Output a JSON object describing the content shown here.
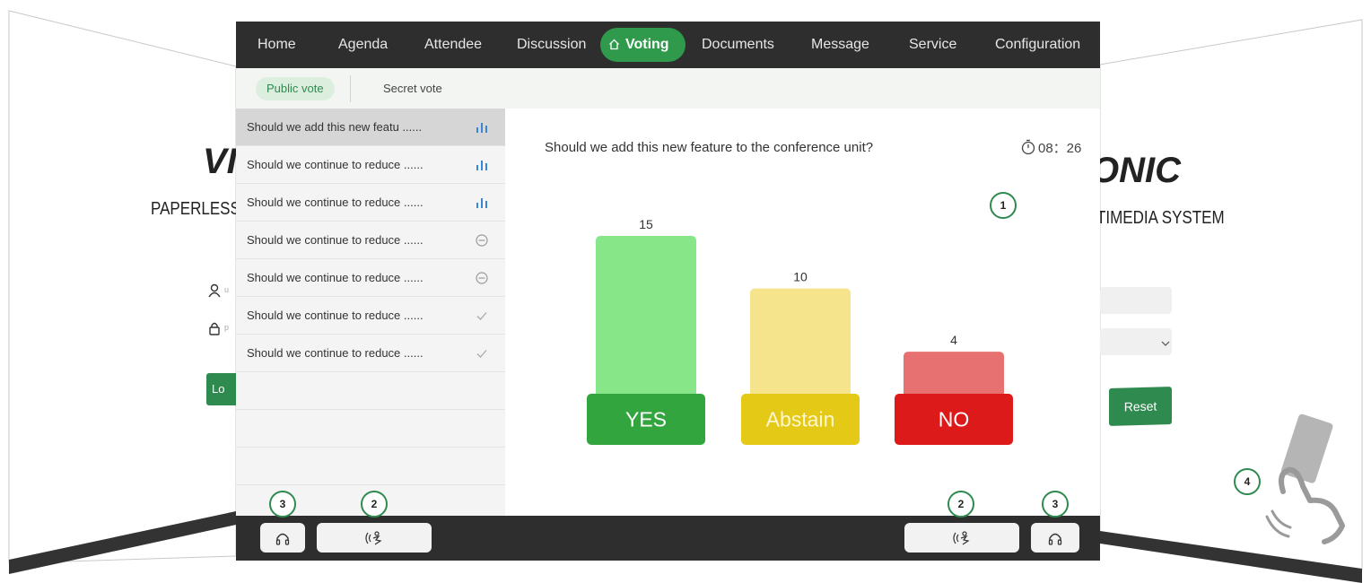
{
  "background": {
    "left_brand": "VI",
    "left_subtitle": "PAPERLESS",
    "right_brand": "ONIC",
    "right_subtitle": "TIMEDIA SYSTEM",
    "left_login_label": "Lo",
    "left_user_hint": "u",
    "left_pass_hint": "p",
    "right_reset_label": "Reset",
    "card_icon": "card-tap-icon"
  },
  "nav": {
    "items": [
      {
        "label": "Home"
      },
      {
        "label": "Agenda"
      },
      {
        "label": "Attendee"
      },
      {
        "label": "Discussion"
      },
      {
        "label": "Voting"
      },
      {
        "label": "Documents"
      },
      {
        "label": "Message"
      },
      {
        "label": "Service"
      },
      {
        "label": "Configuration"
      }
    ],
    "active_index": 4,
    "active_icon": "home-outline-icon"
  },
  "tabs": {
    "public": "Public vote",
    "secret": "Secret vote"
  },
  "vote_list": [
    {
      "title": "Should we add this new featu ......",
      "status_icon": "bar-chart-icon"
    },
    {
      "title": "Should we continue to reduce ......",
      "status_icon": "bar-chart-icon"
    },
    {
      "title": "Should we continue to reduce ......",
      "status_icon": "bar-chart-icon"
    },
    {
      "title": "Should we continue to reduce ......",
      "status_icon": "minus-circle-icon"
    },
    {
      "title": "Should we continue to reduce ......",
      "status_icon": "minus-circle-icon"
    },
    {
      "title": "Should we continue to reduce ......",
      "status_icon": "check-icon"
    },
    {
      "title": "Should we continue to reduce ......",
      "status_icon": "check-icon"
    }
  ],
  "question": "Should we add this new feature to the conference unit?",
  "timer": "08：26",
  "chart_data": {
    "type": "bar",
    "categories": [
      "YES",
      "Abstain",
      "NO"
    ],
    "values": [
      15,
      10,
      4
    ],
    "colors": [
      "#86e688",
      "#f5e48c",
      "#e77070"
    ],
    "label_colors": [
      "#33a53f",
      "#e5c917",
      "#dd1a1a"
    ],
    "label_text_colors": [
      "#ffffff",
      "#fff7d0",
      "#ffffff"
    ],
    "title": "",
    "xlabel": "",
    "ylabel": "",
    "ylim": [
      0,
      15
    ]
  },
  "bottom_bar": {
    "left_buttons": [
      "headphone-icon",
      "microphone-speak-icon"
    ],
    "right_buttons": [
      "microphone-speak-icon",
      "headphone-icon"
    ]
  },
  "markers": {
    "chart_marker": "1",
    "speak_marker": "2",
    "headphone_marker": "3",
    "card_marker": "4"
  },
  "colors": {
    "accent": "#2f9a4c",
    "nav_bg": "#2e2e2e"
  }
}
